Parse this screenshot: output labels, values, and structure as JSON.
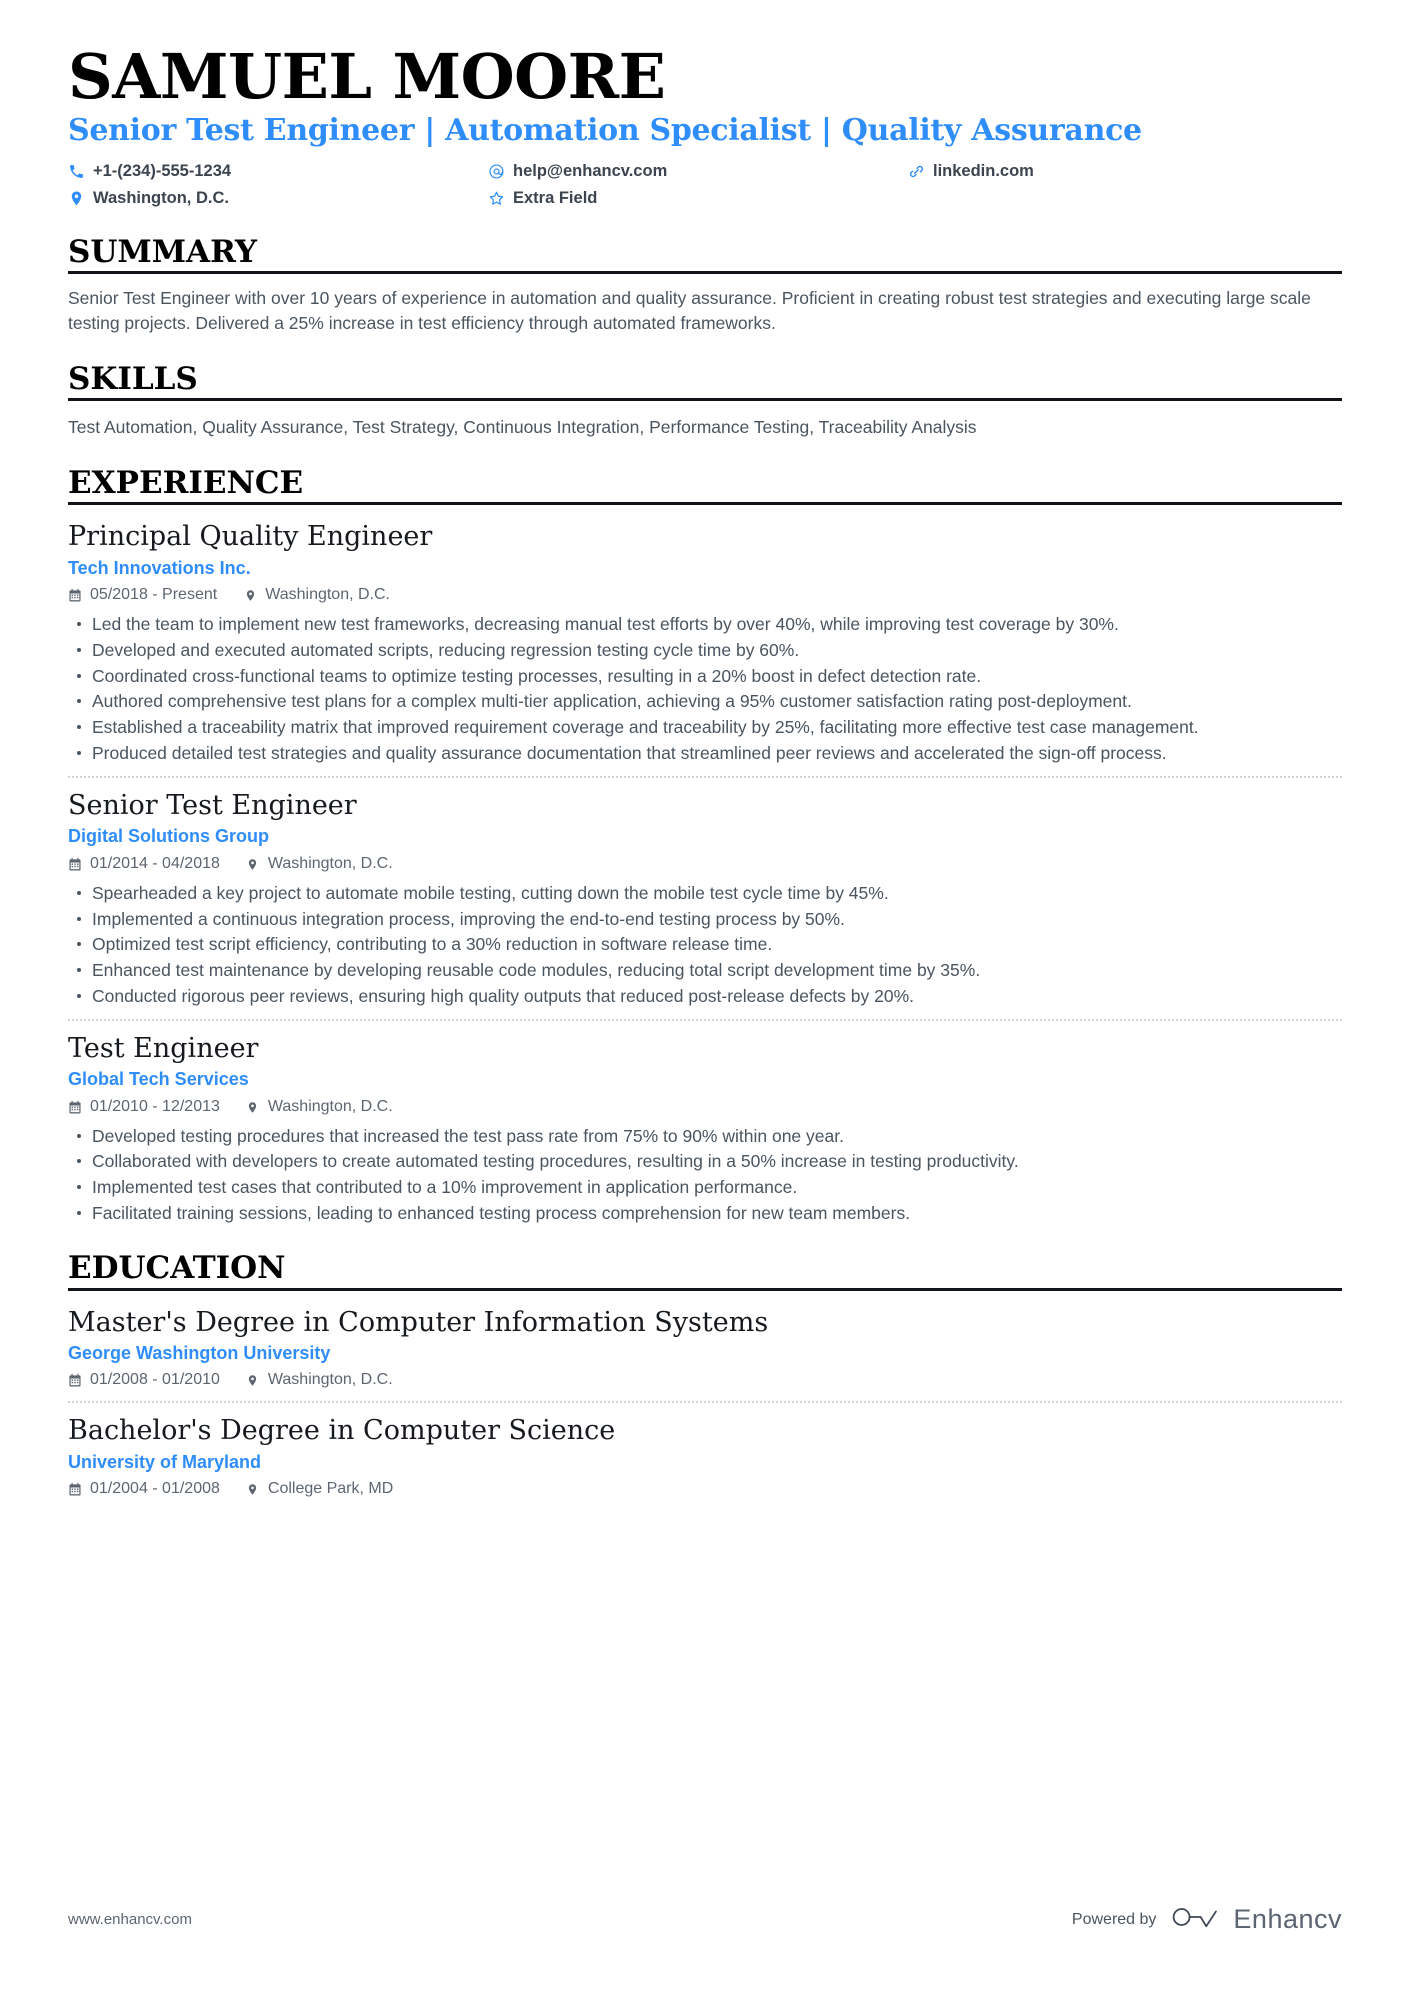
{
  "header": {
    "name": "SAMUEL MOORE",
    "headline": "Senior Test Engineer | Automation Specialist | Quality Assurance",
    "accent_color": "#2f8dfa",
    "contacts": [
      {
        "icon": "phone-icon",
        "text": "+1-(234)-555-1234"
      },
      {
        "icon": "email-icon",
        "text": "help@enhancv.com"
      },
      {
        "icon": "link-icon",
        "text": "linkedin.com"
      },
      {
        "icon": "location-icon",
        "text": "Washington, D.C."
      },
      {
        "icon": "star-icon",
        "text": "Extra Field"
      }
    ]
  },
  "sections": {
    "summary": {
      "title": "SUMMARY",
      "text": "Senior Test Engineer with over 10 years of experience in automation and quality assurance. Proficient in creating robust test strategies and executing large scale testing projects. Delivered a 25% increase in test efficiency through automated frameworks."
    },
    "skills": {
      "title": "SKILLS",
      "text": "Test Automation, Quality Assurance, Test Strategy, Continuous Integration, Performance Testing, Traceability Analysis"
    },
    "experience": {
      "title": "EXPERIENCE",
      "entries": [
        {
          "title": "Principal Quality Engineer",
          "org": "Tech Innovations Inc.",
          "date": "05/2018 - Present",
          "location": "Washington, D.C.",
          "bullets": [
            "Led the team to implement new test frameworks, decreasing manual test efforts by over 40%, while improving test coverage by 30%.",
            "Developed and executed automated scripts, reducing regression testing cycle time by 60%.",
            "Coordinated cross-functional teams to optimize testing processes, resulting in a 20% boost in defect detection rate.",
            "Authored comprehensive test plans for a complex multi-tier application, achieving a 95% customer satisfaction rating post-deployment.",
            "Established a traceability matrix that improved requirement coverage and traceability by 25%, facilitating more effective test case management.",
            "Produced detailed test strategies and quality assurance documentation that streamlined peer reviews and accelerated the sign-off process."
          ]
        },
        {
          "title": "Senior Test Engineer",
          "org": "Digital Solutions Group",
          "date": "01/2014 - 04/2018",
          "location": "Washington, D.C.",
          "bullets": [
            "Spearheaded a key project to automate mobile testing, cutting down the mobile test cycle time by 45%.",
            "Implemented a continuous integration process, improving the end-to-end testing process by 50%.",
            "Optimized test script efficiency, contributing to a 30% reduction in software release time.",
            "Enhanced test maintenance by developing reusable code modules, reducing total script development time by 35%.",
            "Conducted rigorous peer reviews, ensuring high quality outputs that reduced post-release defects by 20%."
          ]
        },
        {
          "title": "Test Engineer",
          "org": "Global Tech Services",
          "date": "01/2010 - 12/2013",
          "location": "Washington, D.C.",
          "bullets": [
            "Developed testing procedures that increased the test pass rate from 75% to 90% within one year.",
            "Collaborated with developers to create automated testing procedures, resulting in a 50% increase in testing productivity.",
            "Implemented test cases that contributed to a 10% improvement in application performance.",
            "Facilitated training sessions, leading to enhanced testing process comprehension for new team members."
          ]
        }
      ]
    },
    "education": {
      "title": "EDUCATION",
      "entries": [
        {
          "title": "Master's Degree in Computer Information Systems",
          "org": "George Washington University",
          "date": "01/2008 - 01/2010",
          "location": "Washington, D.C."
        },
        {
          "title": "Bachelor's Degree in Computer Science",
          "org": "University of Maryland",
          "date": "01/2004 - 01/2008",
          "location": "College Park, MD"
        }
      ]
    }
  },
  "footer": {
    "url": "www.enhancv.com",
    "powered_by": "Powered by",
    "brand": "Enhancv"
  }
}
